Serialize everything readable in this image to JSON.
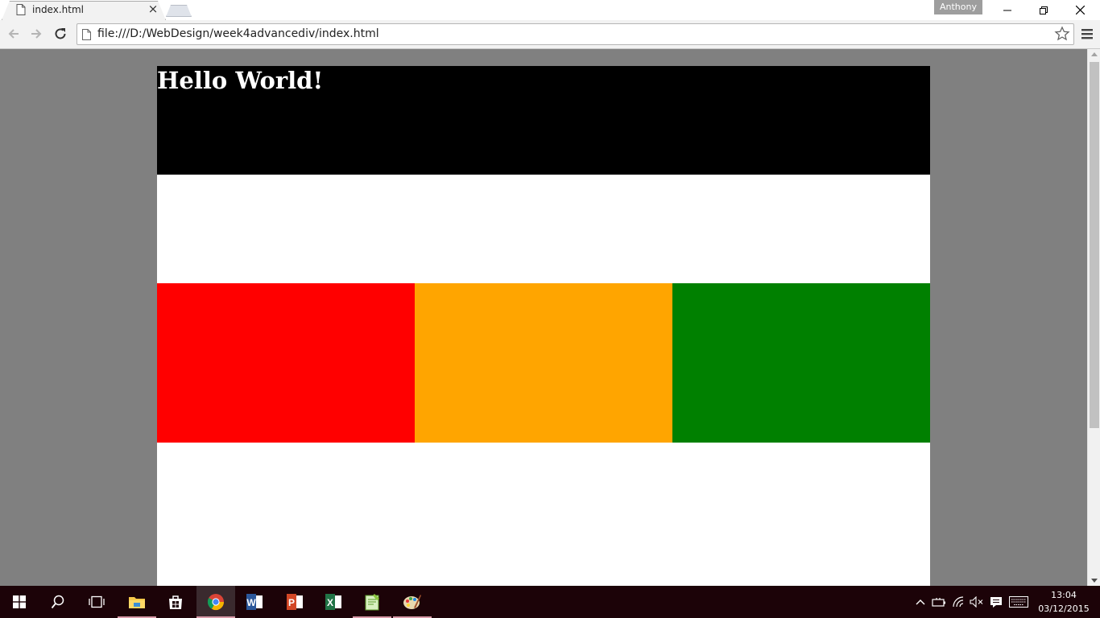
{
  "browser": {
    "tab_title": "index.html",
    "tab_close": "×",
    "profile_name": "Anthony",
    "url": "file:///D:/WebDesign/week4advancediv/index.html"
  },
  "page": {
    "heading": "Hello World!",
    "colors": {
      "page_background": "#808080",
      "wrapper": "#ffffff",
      "header": "#000000",
      "columns": [
        "#ff0000",
        "#ffa500",
        "#008000"
      ]
    }
  },
  "taskbar": {
    "pinned_icons": [
      "start-icon",
      "search-icon",
      "task-view-icon",
      "file-explorer-icon",
      "store-icon",
      "chrome-icon",
      "word-icon",
      "powerpoint-icon",
      "excel-icon",
      "notepad-plus-icon",
      "paint-icon"
    ],
    "active_app": "chrome-icon",
    "time": "13:04",
    "date": "03/12/2015"
  }
}
